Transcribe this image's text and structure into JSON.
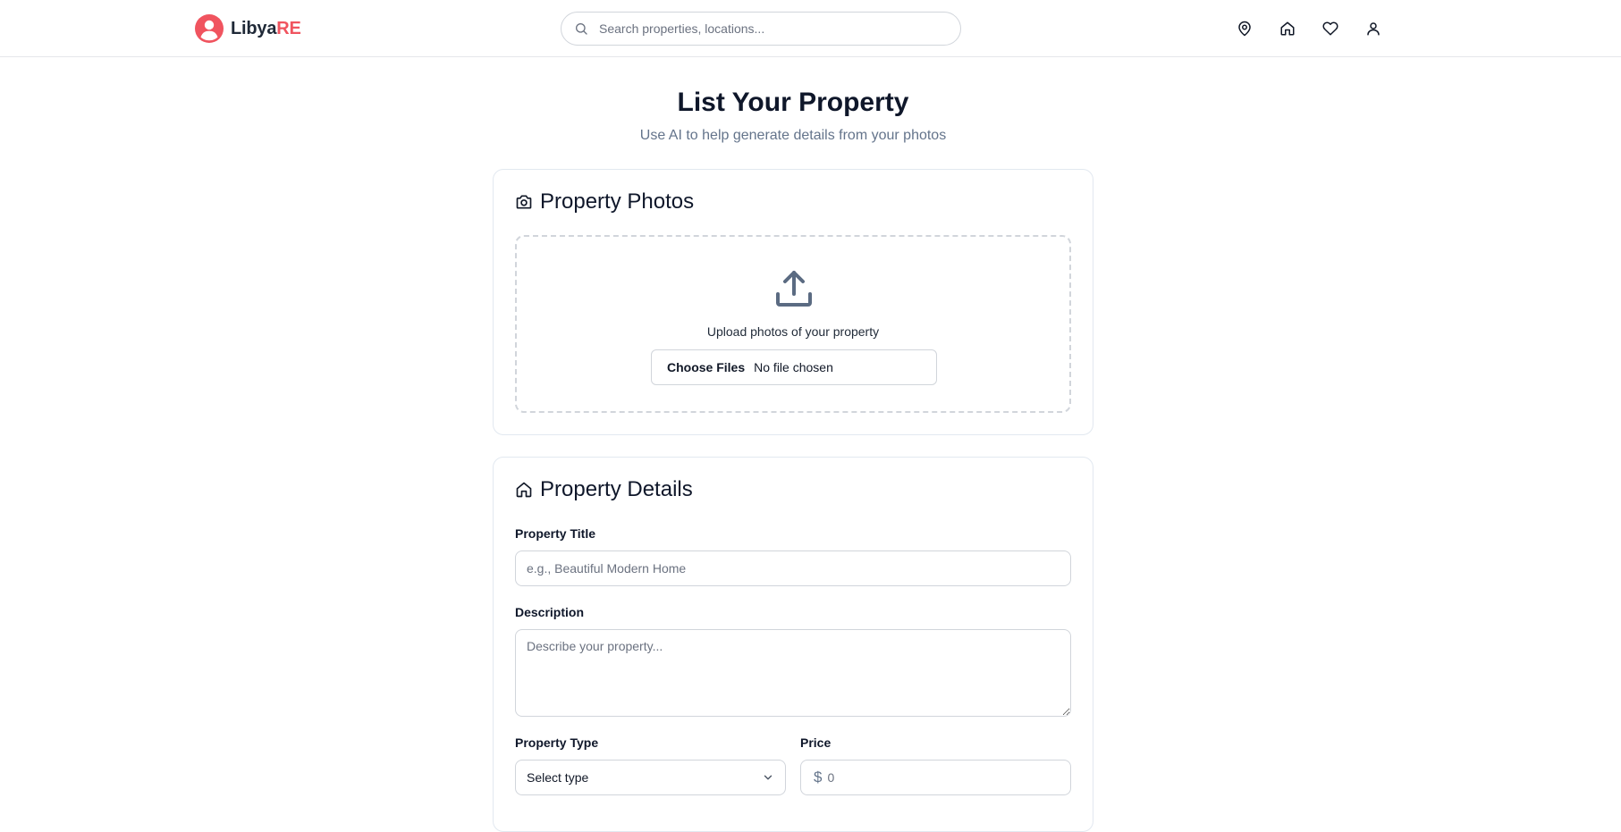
{
  "header": {
    "brand_main": "Libya",
    "brand_accent": "RE",
    "search_placeholder": "Search properties, locations...",
    "nav_icons": [
      "map-pin-icon",
      "home-icon",
      "heart-icon",
      "user-icon"
    ]
  },
  "page": {
    "title": "List Your Property",
    "subtitle": "Use AI to help generate details from your photos"
  },
  "photos": {
    "title": "Property Photos",
    "upload_text": "Upload photos of your property",
    "choose_files_label": "Choose Files",
    "file_status": "No file chosen"
  },
  "details": {
    "title": "Property Details",
    "title_label": "Property Title",
    "title_placeholder": "e.g., Beautiful Modern Home",
    "description_label": "Description",
    "description_placeholder": "Describe your property...",
    "type_label": "Property Type",
    "type_selected": "Select type",
    "price_label": "Price",
    "price_symbol": "$",
    "price_placeholder": "0"
  },
  "colors": {
    "brand_accent": "#f0545f",
    "muted_text": "#64748b",
    "border": "#d1d5db"
  }
}
